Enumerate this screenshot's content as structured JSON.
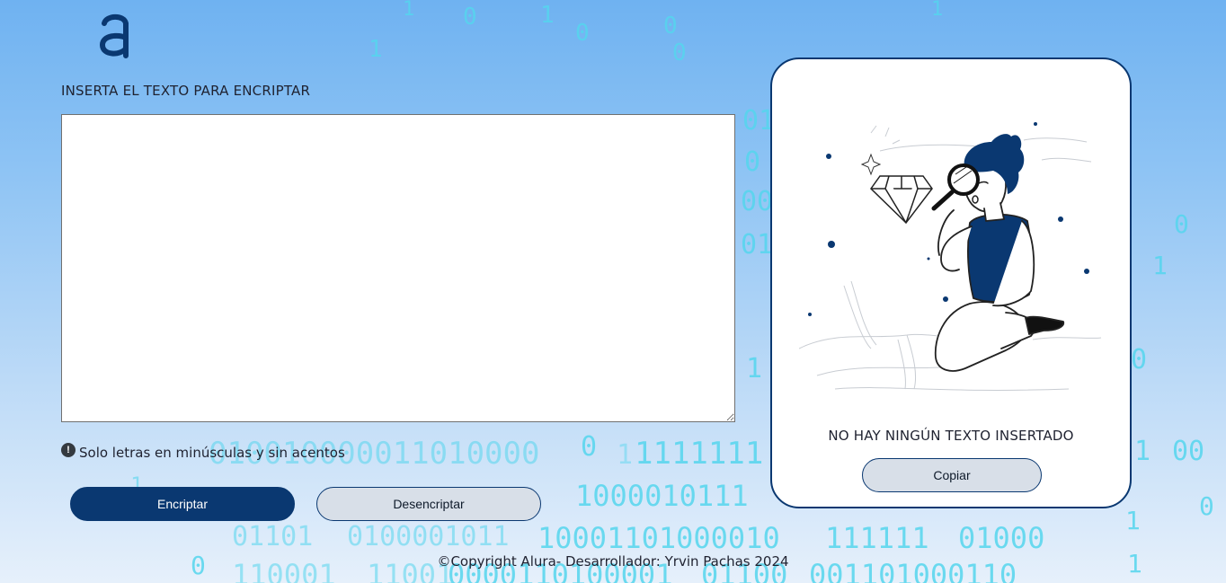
{
  "header": {
    "logo_icon": "alura-a-logo"
  },
  "input_section": {
    "label": "INSERTA EL TEXTO PARA ENCRIPTAR",
    "textarea_value": "",
    "hint_icon": "exclamation-circle-icon",
    "hint_text": "Solo letras en minúsculas y sin acentos"
  },
  "buttons": {
    "encrypt_label": "Encriptar",
    "decrypt_label": "Desencriptar"
  },
  "output_panel": {
    "illustration": "person-with-magnifier-diamond-illustration",
    "empty_message": "NO HAY NINGÚN TEXTO INSERTADO",
    "copy_label": "Copiar"
  },
  "footer": {
    "text": "©Copyright Alura- Desarrollador: Yrvin Pachas 2024"
  },
  "background_digits": [
    "1",
    "0",
    "1",
    "0",
    "0",
    "1",
    "0",
    "1",
    "0",
    "01",
    "0",
    "1",
    "00",
    "01",
    "0",
    "1",
    "010010000011010000",
    "0",
    "1",
    "1111111",
    "1",
    "00",
    "1",
    "1000010111",
    "0",
    "01101",
    "0100001011",
    "10001101000010",
    "111111",
    "01000",
    "1",
    "0",
    "1",
    "110001",
    "11001",
    "0000110100001",
    "01100",
    "001101000110"
  ],
  "colors": {
    "primary": "#0a3871",
    "secondary_button": "#d8dfe8",
    "digit_color": "#55d6ee"
  }
}
